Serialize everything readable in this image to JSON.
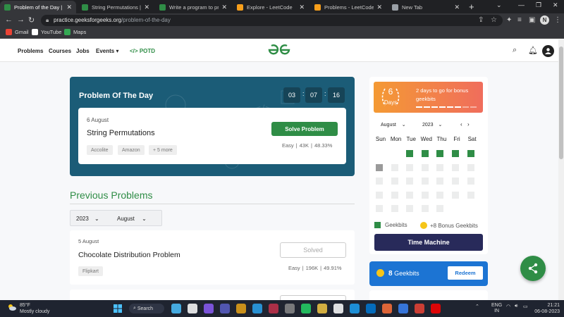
{
  "browser": {
    "tabs": [
      {
        "title": "Problem of the Day | Geeks",
        "favicon": "gfg-icon",
        "color": "#2f8d46"
      },
      {
        "title": "String Permutations | Practi",
        "favicon": "gfg-icon",
        "color": "#2f8d46"
      },
      {
        "title": "Write a program to print all",
        "favicon": "gfg-icon",
        "color": "#2f8d46"
      },
      {
        "title": "Explore - LeetCode",
        "favicon": "leetcode-icon",
        "color": "#f89f1b"
      },
      {
        "title": "Problems - LeetCode",
        "favicon": "leetcode-icon",
        "color": "#f89f1b"
      },
      {
        "title": "New Tab",
        "favicon": "chrome-icon",
        "color": "#9aa0a6"
      }
    ],
    "url_host": "practice.geeksforgeeks.org",
    "url_path": "/problem-of-the-day",
    "profile_initial": "N",
    "bookmarks": [
      {
        "label": "Gmail",
        "color": "#ea4335"
      },
      {
        "label": "YouTube",
        "color": "#ffffff"
      },
      {
        "label": "Maps",
        "color": "#34a853"
      }
    ]
  },
  "site": {
    "nav": [
      "Problems",
      "Courses",
      "Jobs",
      "Events",
      "POTD"
    ],
    "events_chevron": "⌄",
    "potd_prefix": "</>",
    "logo": "ꞓG",
    "user_initial": "👤"
  },
  "potd": {
    "title": "Problem Of The Day",
    "timer": [
      "03",
      "07",
      "16"
    ],
    "date": "6 August",
    "problem": "String Permutations",
    "tags": [
      "Accolite",
      "Amazon",
      "+ 5 more"
    ],
    "solve_label": "Solve Problem",
    "difficulty": "Easy",
    "submissions": "43K",
    "accuracy": "48.33%"
  },
  "previous": {
    "heading": "Previous Problems",
    "year": "2023",
    "month": "August",
    "items": [
      {
        "date": "5 August",
        "name": "Chocolate Distribution Problem",
        "tag": "Flipkart",
        "status": "Solved",
        "difficulty": "Easy",
        "submissions": "196K",
        "accuracy": "49.91%"
      }
    ]
  },
  "streak": {
    "days": "6",
    "days_label": "Days",
    "message": "2 days to go for bonus geekbits",
    "progress_segments": 8,
    "progress_filled": 6
  },
  "calendar": {
    "month": "August",
    "year": "2023",
    "prev": "‹",
    "next": "›",
    "weekdays": [
      "Sun",
      "Mon",
      "Tue",
      "Wed",
      "Thu",
      "Fri",
      "Sat"
    ],
    "first_weekday": 2,
    "days_in_month": 31,
    "solved_days": [
      1,
      2,
      3,
      4,
      5
    ],
    "today": 6
  },
  "legend": {
    "geekbits": "Geekbits",
    "bonus": "+8 Bonus Geekbits"
  },
  "time_machine": "Time Machine",
  "geekbits_card": {
    "count": "8",
    "label": "Geekbits",
    "redeem": "Redeem"
  },
  "taskbar": {
    "temp": "85°F",
    "weather": "Mostly cloudy",
    "search": "Search",
    "lang": "ENG",
    "region": "IN",
    "time": "21:21",
    "date": "06-08-2023",
    "apps": [
      "#4cc2ff",
      "#ffffff",
      "#8b5cf6",
      "#5b5fc7",
      "#e8a317",
      "#2aa3ef",
      "#c4314b",
      "#888888",
      "#25d366",
      "#f2c744",
      "#ffffff",
      "#1da1f2",
      "#0078d4",
      "#ff7139",
      "#3b82f6",
      "#ea4335",
      "#ff0000"
    ]
  }
}
